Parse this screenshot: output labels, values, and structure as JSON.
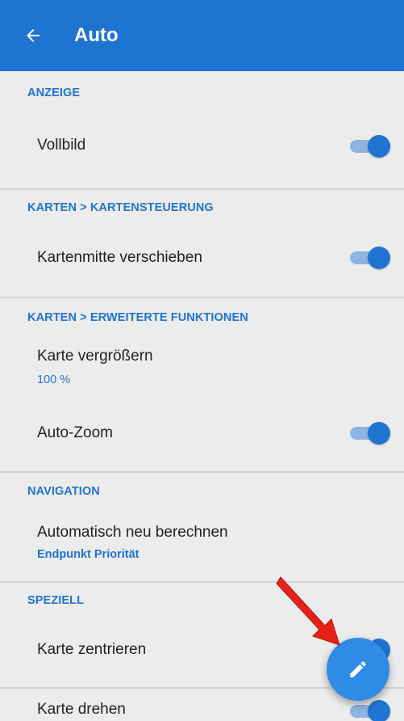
{
  "appbar": {
    "title": "Auto",
    "back_icon": "arrow-left-icon"
  },
  "sections": {
    "anzeige": "ANZEIGE",
    "kartensteuerung": "KARTEN > KARTENSTEUERUNG",
    "erweiterte": "KARTEN > ERWEITERTE FUNKTIONEN",
    "navigation": "NAVIGATION",
    "speziell": "SPEZIELL"
  },
  "settings": {
    "vollbild": {
      "label": "Vollbild",
      "enabled": true
    },
    "kartenmitte": {
      "label": "Kartenmitte verschieben",
      "enabled": true
    },
    "vergroessern": {
      "label": "Karte vergrößern",
      "value": "100 %"
    },
    "autozoom": {
      "label": "Auto-Zoom",
      "enabled": true
    },
    "neuberechnen": {
      "label": "Automatisch neu berechnen",
      "value": "Endpunkt Priorität"
    },
    "zentrieren": {
      "label": "Karte zentrieren",
      "enabled": true
    },
    "drehen": {
      "label": "Karte drehen",
      "enabled": true
    }
  },
  "fab": {
    "icon": "pencil-icon"
  },
  "annotation": {
    "icon": "red-arrow-icon",
    "color": "#e8201a"
  },
  "colors": {
    "accent": "#1f74d2",
    "background": "#ececec",
    "toggle_track": "#8fb4e2"
  }
}
